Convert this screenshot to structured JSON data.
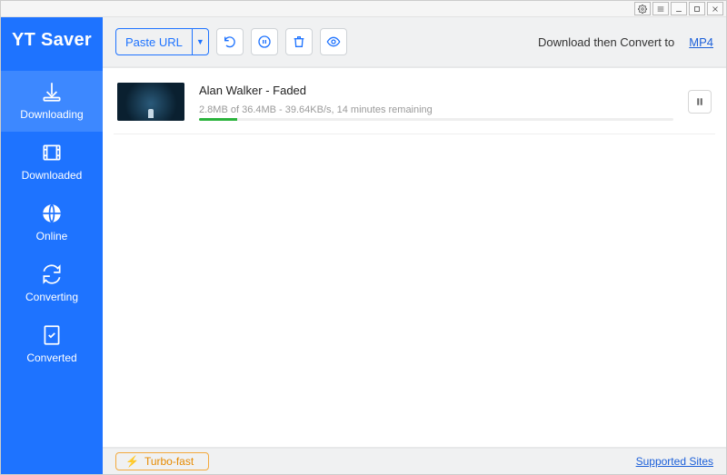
{
  "app": {
    "name": "YT Saver"
  },
  "titlebar": {
    "buttons": [
      "settings",
      "menu",
      "minimize",
      "maximize",
      "close"
    ]
  },
  "sidebar": {
    "items": [
      {
        "key": "downloading",
        "label": "Downloading"
      },
      {
        "key": "downloaded",
        "label": "Downloaded"
      },
      {
        "key": "online",
        "label": "Online"
      },
      {
        "key": "converting",
        "label": "Converting"
      },
      {
        "key": "converted",
        "label": "Converted"
      }
    ],
    "active": "downloading"
  },
  "toolbar": {
    "paste_label": "Paste URL",
    "convert_prefix": "Download then Convert to",
    "convert_format": "MP4"
  },
  "download": {
    "title": "Alan Walker - Faded",
    "status": "2.8MB of 36.4MB - 39.64KB/s, 14 minutes remaining",
    "progress_percent": 8
  },
  "footer": {
    "turbo_label": "Turbo-fast",
    "supported_label": "Supported Sites"
  }
}
